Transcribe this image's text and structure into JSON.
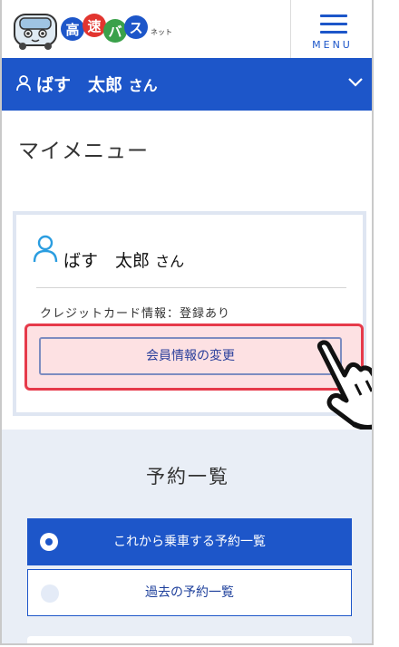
{
  "header": {
    "logo_text": "高速バス",
    "logo_suffix": "ネット",
    "menu_label": "MENU"
  },
  "userbar": {
    "name": "ばす　太郎",
    "suffix": "さん"
  },
  "page_title": "マイメニュー",
  "card": {
    "name": "ばす　太郎",
    "suffix": "さん",
    "credit_info": "クレジットカード情報：登録あり",
    "change_button": "会員情報の変更"
  },
  "reservations": {
    "title": "予約一覧",
    "upcoming_button": "これから乗車する予約一覧",
    "past_button": "過去の予約一覧"
  },
  "colors": {
    "brand_blue": "#1d56c9",
    "highlight_red": "#e63a4a",
    "highlight_fill": "#fde1e3"
  }
}
